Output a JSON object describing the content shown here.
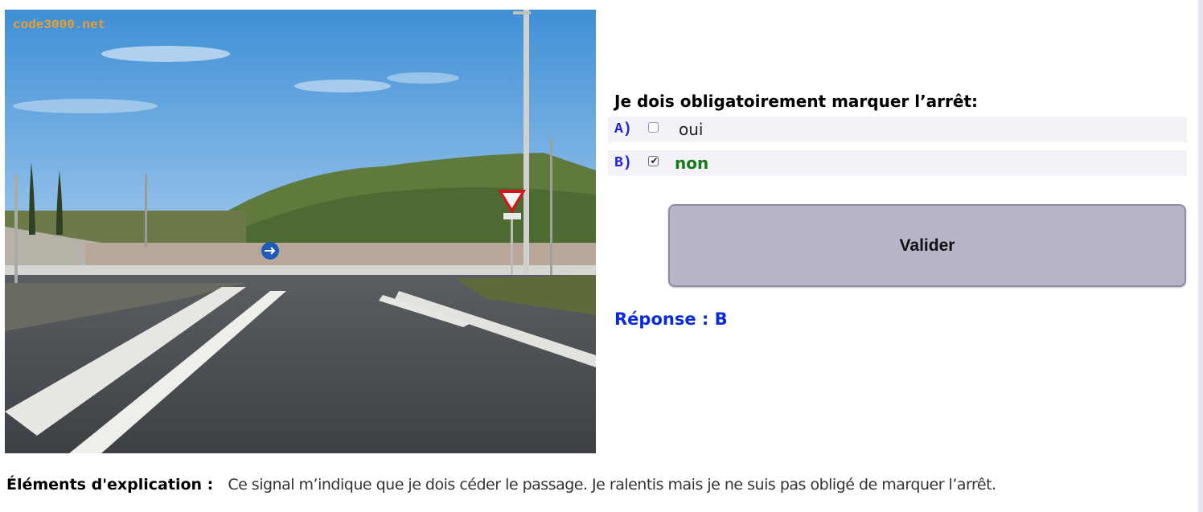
{
  "photo": {
    "watermark": "code3000.net",
    "alt_description_icon": "yield-sign-icon"
  },
  "question": {
    "text": "Je dois obligatoirement marquer l’arrêt:",
    "options": [
      {
        "letter": "A)",
        "label": "oui",
        "checked": false
      },
      {
        "letter": "B)",
        "label": "non",
        "checked": true
      }
    ]
  },
  "actions": {
    "validate_label": "Valider"
  },
  "answer": {
    "text": "Réponse : B"
  },
  "explanation": {
    "label": "Éléments d'explication :",
    "text": "Ce signal m’indique que je dois céder le passage. Je ralentis mais je ne suis pas obligé de marquer l’arrêt."
  },
  "colors": {
    "option_letter": "#2020dd",
    "selected_answer": "#1a7a1a",
    "answer_text": "#0b2bd8",
    "button_bg": "#b6b5c9"
  }
}
